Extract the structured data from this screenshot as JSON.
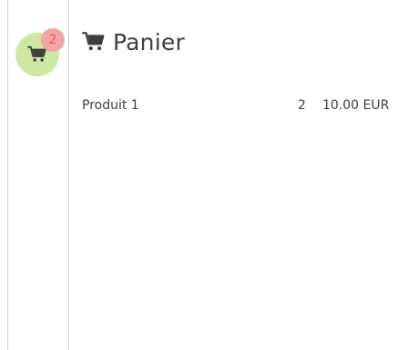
{
  "sidebar": {
    "cart_button": {
      "icon": "shopping-cart-icon",
      "badge_count": "2",
      "background_color": "#cfe7a3",
      "badge_color": "#f3a6a6"
    }
  },
  "panel": {
    "title_icon": "shopping-cart-icon",
    "title": "Panier",
    "items": [
      {
        "name": "Produit 1",
        "quantity": "2",
        "price": "10.00 EUR"
      }
    ]
  }
}
